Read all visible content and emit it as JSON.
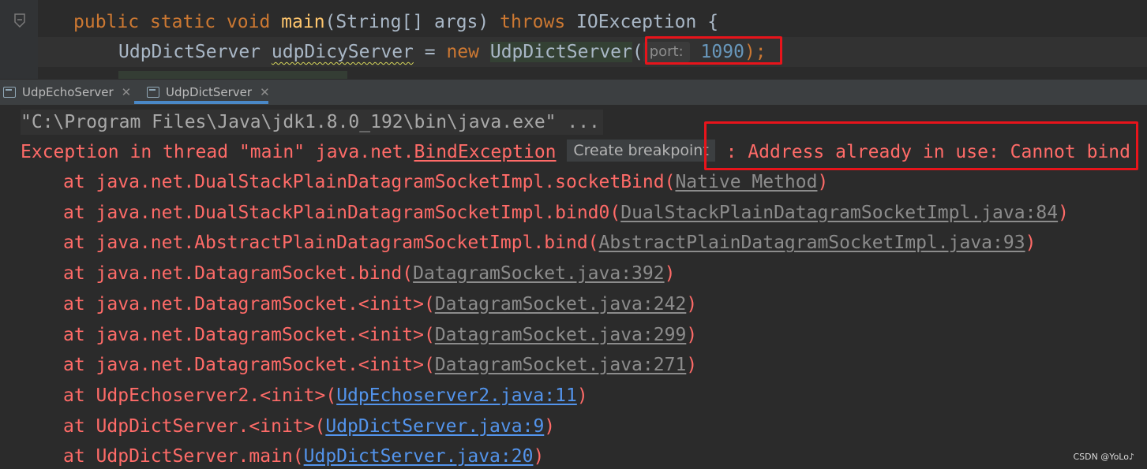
{
  "editor": {
    "line1": {
      "kw1": "public",
      "kw2": "static",
      "kw3": "void",
      "method": "main",
      "params": "(String[] args) ",
      "throws_kw": "throws",
      "exception": " IOException {"
    },
    "line2": {
      "type": "UdpDictServer ",
      "var": "udpDicyServer",
      "assign": " = ",
      "new_kw": "new",
      "space": " ",
      "class": "UdpDictServer",
      "paren": "(",
      "hint": "port:",
      "value": "1090",
      "end": ");"
    }
  },
  "tabs": [
    {
      "label": "UdpEchoServer",
      "active": false
    },
    {
      "label": "UdpDictServer",
      "active": true
    }
  ],
  "console": {
    "command": "\"C:\\Program Files\\Java\\jdk1.8.0_192\\bin\\java.exe\" ...",
    "exception_prefix": "Exception in thread \"main\" java.net.",
    "exception_class": "BindException",
    "tooltip": "Create breakpoint",
    "exception_message": " : Address already in use: Cannot bind",
    "stack": [
      {
        "text": "at java.net.DualStackPlainDatagramSocketImpl.socketBind(",
        "link": "Native Method",
        "link_style": "grey",
        "end": ")"
      },
      {
        "text": "at java.net.DualStackPlainDatagramSocketImpl.bind0(",
        "link": "DualStackPlainDatagramSocketImpl.java:84",
        "link_style": "grey",
        "end": ")"
      },
      {
        "text": "at java.net.AbstractPlainDatagramSocketImpl.bind(",
        "link": "AbstractPlainDatagramSocketImpl.java:93",
        "link_style": "grey",
        "end": ")"
      },
      {
        "text": "at java.net.DatagramSocket.bind(",
        "link": "DatagramSocket.java:392",
        "link_style": "grey",
        "end": ")"
      },
      {
        "text": "at java.net.DatagramSocket.<init>(",
        "link": "DatagramSocket.java:242",
        "link_style": "grey",
        "end": ")"
      },
      {
        "text": "at java.net.DatagramSocket.<init>(",
        "link": "DatagramSocket.java:299",
        "link_style": "grey",
        "end": ")"
      },
      {
        "text": "at java.net.DatagramSocket.<init>(",
        "link": "DatagramSocket.java:271",
        "link_style": "grey",
        "end": ")"
      },
      {
        "text": "at UdpEchoserver2.<init>(",
        "link": "UdpEchoserver2.java:11",
        "link_style": "blue",
        "end": ")"
      },
      {
        "text": "at UdpDictServer.<init>(",
        "link": "UdpDictServer.java:9",
        "link_style": "blue",
        "end": ")"
      },
      {
        "text": "at UdpDictServer.main(",
        "link": "UdpDictServer.java:20",
        "link_style": "blue",
        "end": ")"
      }
    ]
  },
  "watermark": "CSDN @YoLo♪",
  "colors": {
    "background": "#2b2b2b",
    "error_text": "#ff6b68",
    "link_blue": "#5394ec",
    "highlight_box": "#e8141b",
    "keyword": "#cc7832"
  }
}
